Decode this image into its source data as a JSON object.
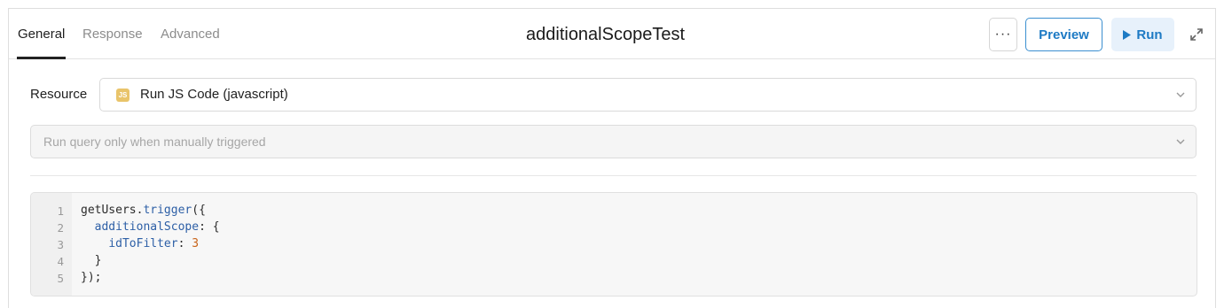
{
  "header": {
    "tabs": [
      {
        "label": "General",
        "active": true
      },
      {
        "label": "Response",
        "active": false
      },
      {
        "label": "Advanced",
        "active": false
      }
    ],
    "title": "additionalScopeTest",
    "more_label": "···",
    "preview_label": "Preview",
    "run_label": "Run",
    "icons": {
      "more": "ellipsis-icon",
      "run": "play-icon",
      "expand": "expand-icon"
    }
  },
  "resource": {
    "label": "Resource",
    "badge": "JS",
    "value": "Run JS Code (javascript)"
  },
  "trigger": {
    "value": "Run query only when manually triggered"
  },
  "editor": {
    "lines": [
      {
        "num": "1",
        "code": "getUsers.trigger({"
      },
      {
        "num": "2",
        "code": "  additionalScope: {"
      },
      {
        "num": "3",
        "code": "    idToFilter: 3"
      },
      {
        "num": "4",
        "code": "  }"
      },
      {
        "num": "5",
        "code": "});"
      }
    ]
  },
  "colors": {
    "accent": "#1d7ac4",
    "run_bg": "#e7f1fb",
    "js_badge": "#e9c46a",
    "number_token": "#c8641a"
  }
}
